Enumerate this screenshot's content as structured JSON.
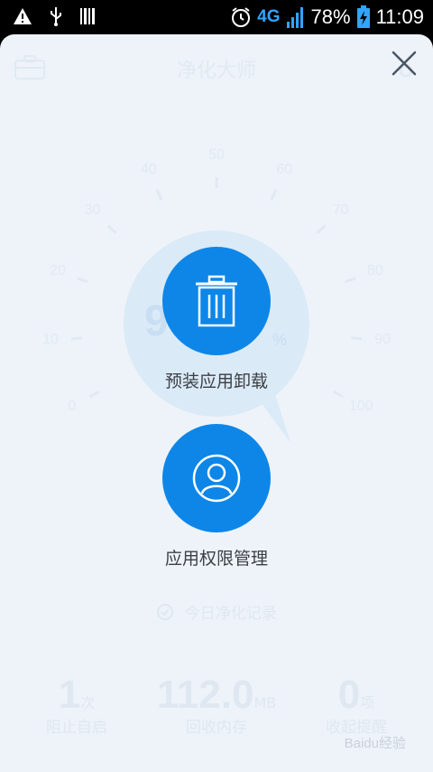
{
  "status_bar": {
    "battery": "78%",
    "time": "11:09",
    "network": "4G"
  },
  "header": {
    "title": "净化大师"
  },
  "dial": {
    "labels": [
      "0",
      "10",
      "20",
      "30",
      "40",
      "50",
      "60",
      "70",
      "80",
      "90",
      "100"
    ],
    "percent_partial": "9",
    "percent_sign": "%"
  },
  "actions": {
    "uninstall_label": "预装应用卸载",
    "permission_label": "应用权限管理"
  },
  "record_label": "今日净化记录",
  "stats": [
    {
      "value": "1",
      "unit": "次",
      "label": "阻止自启"
    },
    {
      "value": "112.0",
      "unit": "MB",
      "label": "回收内存"
    },
    {
      "value": "0",
      "unit": "项",
      "label": "收起提醒"
    }
  ],
  "watermark": "Baidu经验",
  "colors": {
    "accent": "#0d86e8",
    "page_bg": "#eef3f9"
  }
}
